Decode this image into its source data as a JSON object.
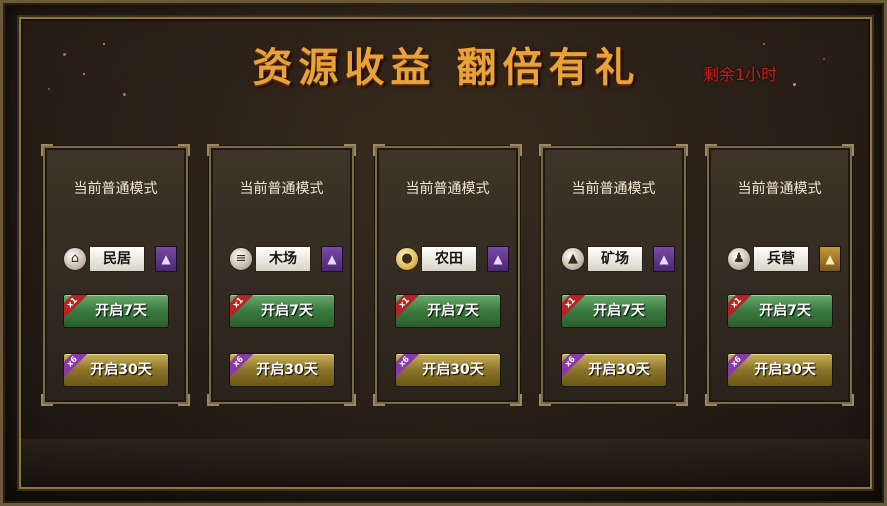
{
  "title": "资源收益  翻倍有礼",
  "timer": "剩余1小时",
  "cards": [
    {
      "mode": "当前普通模式",
      "icon": "house-icon",
      "resource": "民居",
      "open_7": "开启7天",
      "open_30": "开启30天",
      "badge_7": "x1",
      "badge_30": "x6"
    },
    {
      "mode": "当前普通模式",
      "icon": "log-icon",
      "resource": "木场",
      "open_7": "开启7天",
      "open_30": "开启30天",
      "badge_7": "x1",
      "badge_30": "x6"
    },
    {
      "mode": "当前普通模式",
      "icon": "grain-icon",
      "resource": "农田",
      "open_7": "开启7天",
      "open_30": "开启30天",
      "badge_7": "x1",
      "badge_30": "x6"
    },
    {
      "mode": "当前普通模式",
      "icon": "ore-icon",
      "resource": "矿场",
      "open_7": "开启7天",
      "open_30": "开启30天",
      "badge_7": "x1",
      "badge_30": "x6"
    },
    {
      "mode": "当前普通模式",
      "icon": "soldier-icon",
      "resource": "兵营",
      "open_7": "开启7天",
      "open_30": "开启30天",
      "badge_7": "x1",
      "badge_30": "x6"
    }
  ],
  "colors": {
    "title": "#e8a23a",
    "timer": "#c42020",
    "button_green": "#3a7a3e",
    "button_gold": "#8a7428",
    "upgrade_purple": "#7a4aa8",
    "upgrade_gold": "#c89838"
  }
}
